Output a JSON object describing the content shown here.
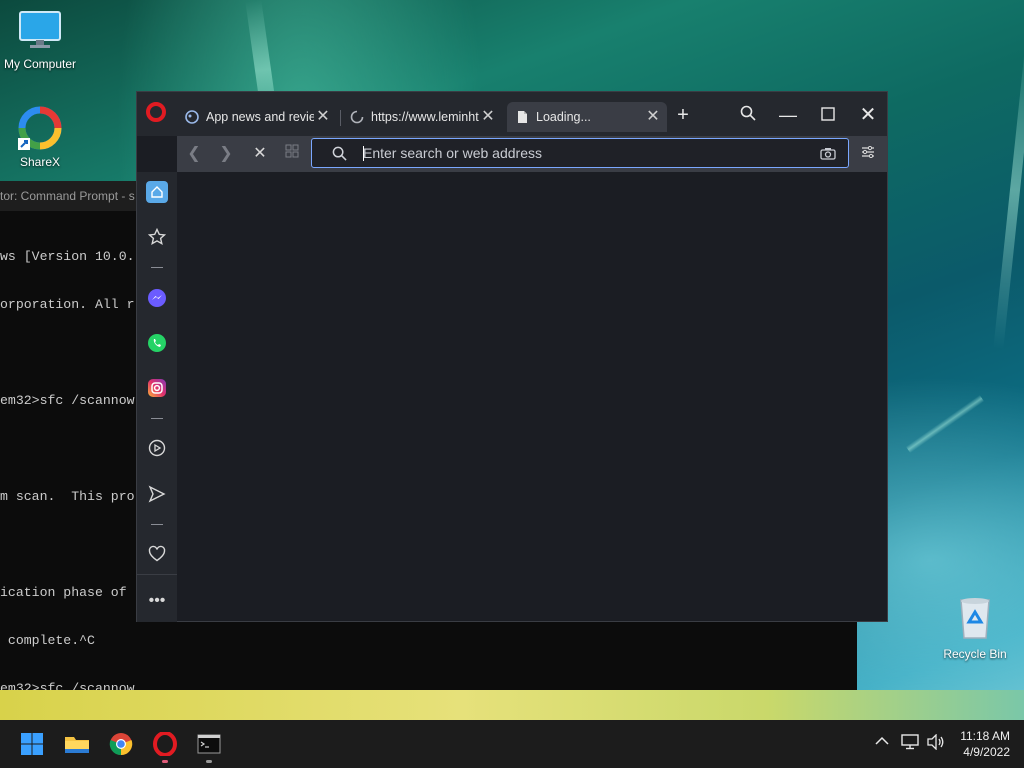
{
  "desktop": {
    "icons": [
      {
        "label": "My Computer"
      },
      {
        "label": "ShareX"
      },
      {
        "label": "Recycle Bin"
      }
    ]
  },
  "cmd": {
    "title": "tor: Command Prompt - s",
    "lines": [
      "ws [Version 10.0.",
      "orporation. All r",
      "",
      "em32>sfc /scannow",
      "",
      "m scan.  This pro",
      "",
      "ication phase of",
      " complete.^C",
      "em32>sfc /scannow"
    ]
  },
  "browser": {
    "tabs": [
      {
        "title": "App news and review",
        "state": "loaded"
      },
      {
        "title": "https://www.leminhtu",
        "state": "loading"
      },
      {
        "title": "Loading...",
        "state": "active"
      }
    ],
    "address": {
      "placeholder": "Enter search or web address",
      "value": ""
    },
    "sidebar_items": [
      "home-icon",
      "bookmarks-icon",
      "messenger-icon",
      "whatsapp-icon",
      "instagram-icon",
      "player-icon",
      "send-icon",
      "heart-icon",
      "more-icon"
    ]
  },
  "taskbar": {
    "apps": [
      "start",
      "file-explorer",
      "chrome",
      "opera",
      "terminal"
    ],
    "clock": {
      "time": "11:18 AM",
      "date": "4/9/2022"
    }
  },
  "colors": {
    "opera_red": "#e11b22",
    "accent_blue": "#7aa7ff",
    "browser_bg": "#1b1d23"
  }
}
